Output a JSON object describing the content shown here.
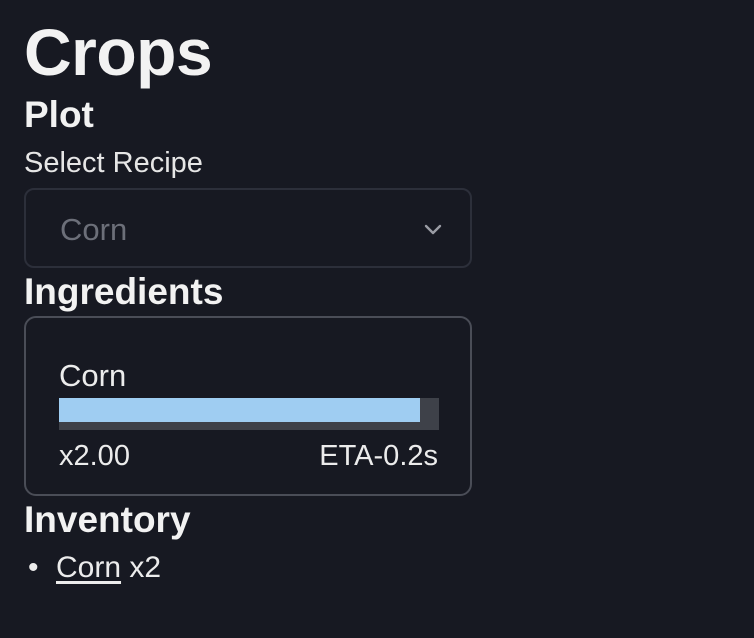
{
  "page": {
    "title": "Crops"
  },
  "plot": {
    "heading": "Plot",
    "select_label": "Select Recipe",
    "selected_recipe": "Corn"
  },
  "ingredients": {
    "heading": "Ingredients",
    "items": [
      {
        "name": "Corn",
        "progress": 0.95,
        "multiplier": "x2.00",
        "eta": "ETA-0.2s"
      }
    ]
  },
  "inventory": {
    "heading": "Inventory",
    "items": [
      {
        "name": "Corn",
        "count": "x2"
      }
    ]
  },
  "colors": {
    "background": "#171922",
    "progress_fill": "#9fcdf2",
    "progress_track": "#3e4149"
  },
  "icons": {
    "select_chevron": "chevron-down-icon"
  }
}
